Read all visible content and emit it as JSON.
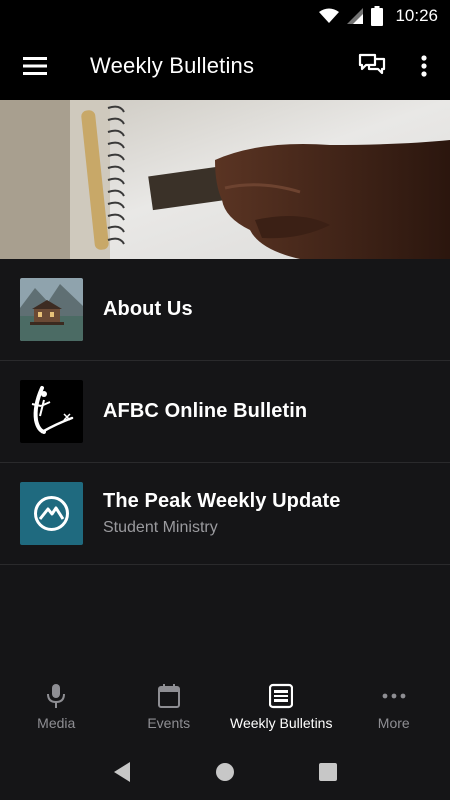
{
  "status_bar": {
    "time": "10:26"
  },
  "app_bar": {
    "title": "Weekly Bulletins"
  },
  "list": [
    {
      "title": "About Us",
      "subtitle": ""
    },
    {
      "title": "AFBC Online Bulletin",
      "subtitle": ""
    },
    {
      "title": "The Peak Weekly Update",
      "subtitle": "Student Ministry"
    }
  ],
  "bottom_nav": [
    {
      "label": "Media",
      "icon": "microphone-icon",
      "active": false
    },
    {
      "label": "Events",
      "icon": "calendar-icon",
      "active": false
    },
    {
      "label": "Weekly Bulletins",
      "icon": "bulletin-icon",
      "active": true
    },
    {
      "label": "More",
      "icon": "more-horizontal-icon",
      "active": false
    }
  ],
  "colors": {
    "background": "#151517",
    "bar": "#000000",
    "inactive": "#8e8e93",
    "peak_tile": "#1f6a7f"
  }
}
